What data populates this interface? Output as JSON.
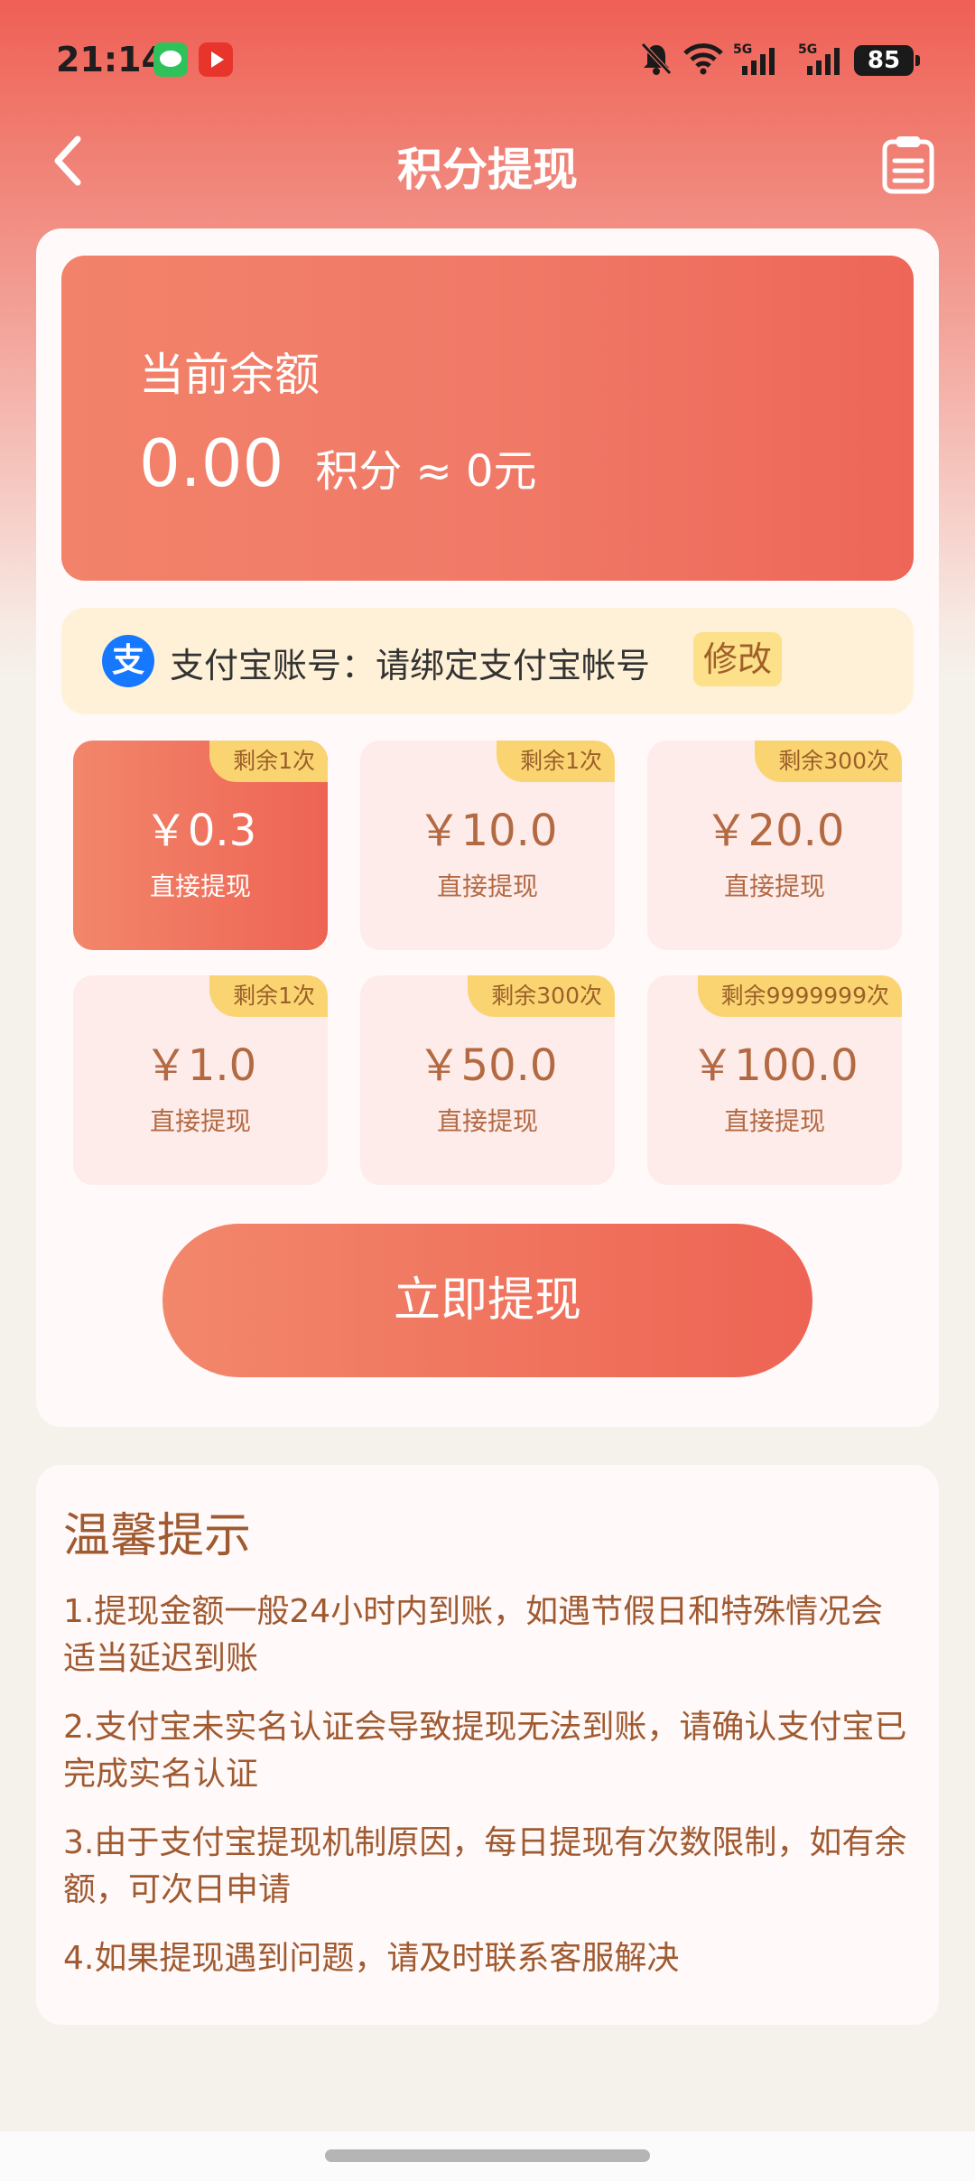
{
  "status_bar": {
    "time": "21:14",
    "battery": "85",
    "icons": [
      "wechat-icon",
      "video-app-icon",
      "bell-muted-icon",
      "wifi-icon",
      "signal-5g-icon",
      "signal-5g-icon"
    ]
  },
  "header": {
    "title": "积分提现",
    "back_icon": "chevron-left-icon",
    "record_icon": "clipboard-list-icon"
  },
  "balance": {
    "label": "当前余额",
    "value": "0.00",
    "unit": "积分",
    "approx": "≈ 0元"
  },
  "alipay": {
    "logo_text": "支",
    "label": "支付宝账号：请绑定支付宝帐号",
    "edit_label": "修改"
  },
  "options": [
    {
      "badge": "剩余1次",
      "amount": "￥0.3",
      "sub": "直接提现",
      "selected": true
    },
    {
      "badge": "剩余1次",
      "amount": "￥10.0",
      "sub": "直接提现",
      "selected": false
    },
    {
      "badge": "剩余300次",
      "amount": "￥20.0",
      "sub": "直接提现",
      "selected": false
    },
    {
      "badge": "剩余1次",
      "amount": "￥1.0",
      "sub": "直接提现",
      "selected": false
    },
    {
      "badge": "剩余300次",
      "amount": "￥50.0",
      "sub": "直接提现",
      "selected": false
    },
    {
      "badge": "剩余9999999次",
      "amount": "￥100.0",
      "sub": "直接提现",
      "selected": false
    }
  ],
  "withdraw_button": "立即提现",
  "tips": {
    "title": "温馨提示",
    "items": [
      "1.提现金额一般24小时内到账，如遇节假日和特殊情况会适当延迟到账",
      "2.支付宝未实名认证会导致提现无法到账，请确认支付宝已完成实名认证",
      "3.由于支付宝提现机制原因，每日提现有次数限制，如有余额，可次日申请",
      "4.如果提现遇到问题，请及时联系客服解决"
    ]
  },
  "colors": {
    "accent": "#ee6454",
    "accent_light": "#f2866b",
    "badge": "#fbd472",
    "tip_text": "#a05a30",
    "alipay_blue": "#1677ff"
  }
}
